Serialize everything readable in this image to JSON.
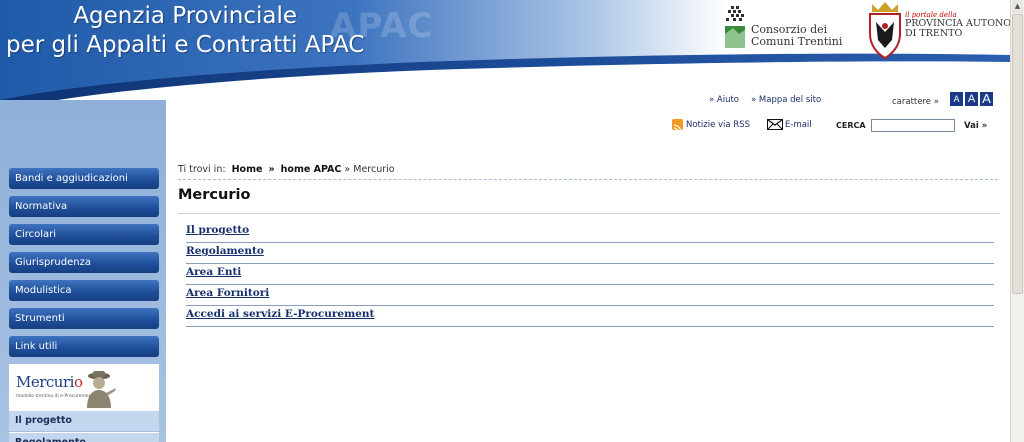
{
  "header": {
    "title_line1": "Agenzia Provinciale",
    "title_line2": "per gli Appalti e Contratti APAC",
    "title_ghost": "APAC",
    "consorzio_line1": "Consorzio dei",
    "consorzio_line2": "Comuni Trentini",
    "provincia_kicker": "il portale della",
    "provincia_line1": "PROVINCIA AUTONOMA",
    "provincia_line2": "DI TRENTO"
  },
  "utility": {
    "help": "» Aiuto",
    "sitemap": "» Mappa del sito",
    "font_label": "carattere »",
    "font_sizes": [
      "A",
      "A",
      "A"
    ],
    "rss": "Notizie via RSS",
    "email": "E-mail",
    "search_label": "CERCA",
    "search_value": "",
    "search_go": "Vai »"
  },
  "sidebar": {
    "items": [
      {
        "label": "Bandi e aggiudicazioni"
      },
      {
        "label": "Normativa"
      },
      {
        "label": "Circolari"
      },
      {
        "label": "Giurisprudenza"
      },
      {
        "label": "Modulistica"
      },
      {
        "label": "Strumenti"
      },
      {
        "label": "Link utili"
      }
    ],
    "mercurio_logo": "Mercurio",
    "mercurio_tagline": "modello trentino di e-Procurement",
    "sub_items": [
      {
        "label": "Il progetto"
      },
      {
        "label": "Regolamento"
      }
    ]
  },
  "breadcrumb": {
    "prefix": "Ti trovi in:",
    "home": "Home",
    "sep1": "»",
    "section": "home APAC",
    "sep2": "»",
    "current": "Mercurio"
  },
  "main": {
    "title": "Mercurio",
    "links": [
      {
        "label": "Il progetto"
      },
      {
        "label": "Regolamento"
      },
      {
        "label": "Area Enti"
      },
      {
        "label": "Area Fornitori"
      },
      {
        "label": "Accedi ai servizi E-Procurement"
      }
    ]
  },
  "colors": {
    "banner_dark": "#163f86",
    "banner_light": "#ffffff",
    "sidebar_bg": "#a9c2e2",
    "nav_button": "#1f4f9a",
    "link": "#17306b"
  },
  "icons": [
    "rss-icon",
    "mail-icon",
    "consorzio-logo",
    "provincia-shield-logo",
    "mercurio-figure"
  ]
}
